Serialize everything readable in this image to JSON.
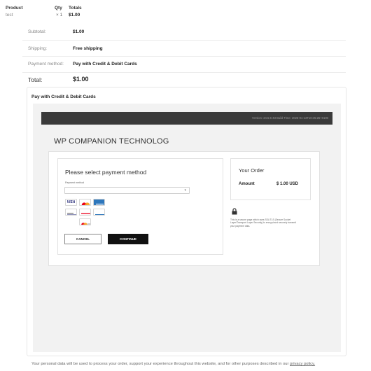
{
  "order_table": {
    "headers": [
      "Product",
      "Qty",
      "Totals"
    ],
    "item": {
      "name": "test",
      "qty": "× 1",
      "total": "$1.00"
    }
  },
  "summary": {
    "subtotal_label": "Subtotal:",
    "subtotal_value": "$1.00",
    "shipping_label": "Shipping:",
    "shipping_value": "Free shipping",
    "payment_label": "Payment method:",
    "payment_value": "Pay with Credit & Debit Cards",
    "total_label": "Total:",
    "total_value": "$1.00"
  },
  "payment_box": {
    "title": "Pay with Credit & Debit Cards"
  },
  "gateway": {
    "version": "Version: 24.5.5-43 Build Time: 2025-01-13T10:45:25+0100",
    "merchant": "WP COMPANION TECHNOLOG",
    "method_title": "Please select payment method",
    "method_label": "Payment method",
    "select_value": "",
    "logos": [
      "VISA",
      "Mastercard",
      "American Express",
      "Verified by VISA",
      "Mastercard ID Check",
      "SafeKey",
      "Mastercard Debit"
    ],
    "cancel_label": "CANCEL",
    "continue_label": "CONTINUE",
    "order_title": "Your Order",
    "amount_label": "Amount",
    "amount_value": "$ 1.00 USD",
    "secure_text": "This is a secure page which uses SSL/TLS (Secure Socket Layer/Transport Layer Security) to encrypt and securely transmit your payment data."
  },
  "privacy": {
    "text": "Your personal data will be used to process your order, support your experience throughout this website, and for other purposes described in our",
    "link": "privacy policy."
  },
  "colors": {
    "visa_blue": "#1a1f71",
    "mc_red": "#eb001b",
    "mc_orange": "#f79e1b",
    "amex_blue": "#2e77bc",
    "dark_bar": "#3a3a3a"
  }
}
